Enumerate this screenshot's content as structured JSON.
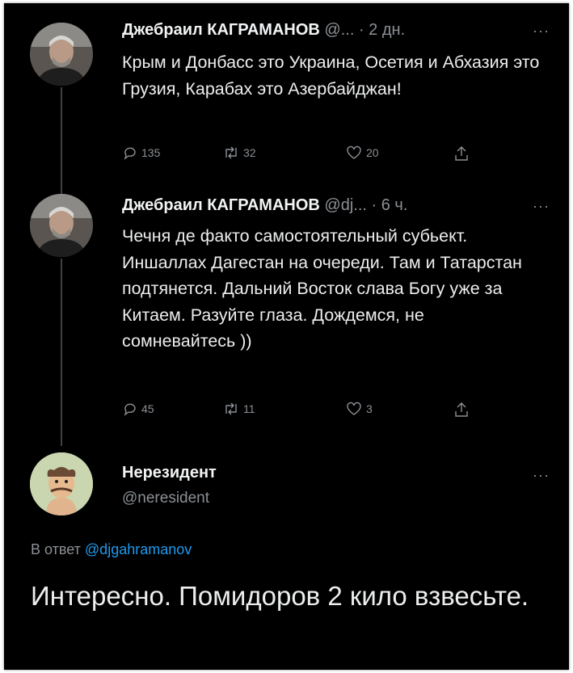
{
  "tweets": [
    {
      "author": "Джебраил КАГРАМАНОВ",
      "handle": "@...",
      "time": "· 2 дн.",
      "more": "···",
      "text": "Крым и Донбасс это Украина, Осетия и Абхазия это Грузия, Карабах это Азербайджан!",
      "replies": "135",
      "retweets": "32",
      "likes": "20"
    },
    {
      "author": "Джебраил КАГРАМАНОВ",
      "handle": "@dj...",
      "time": "· 6 ч.",
      "more": "···",
      "text": "Чечня де факто самостоятельный субьект. Иншаллах Дагестан на очереди. Там и Татарстан подтянется. Дальний Восток слава Богу уже за Китаем. Разуйте глаза. Дождемся, не сомневайтесь ))",
      "replies": "45",
      "retweets": "11",
      "likes": "3"
    }
  ],
  "reply": {
    "author": "Нерезидент",
    "handle": "@neresident",
    "more": "···",
    "in_reply_prefix": "В ответ",
    "in_reply_to": "@djgahramanov",
    "text": "Интересно. Помидоров 2 кило взвесьте."
  },
  "colors": {
    "background": "#000000",
    "text": "#e7e9ea",
    "muted": "#8b9095",
    "link": "#1d9bf0"
  }
}
